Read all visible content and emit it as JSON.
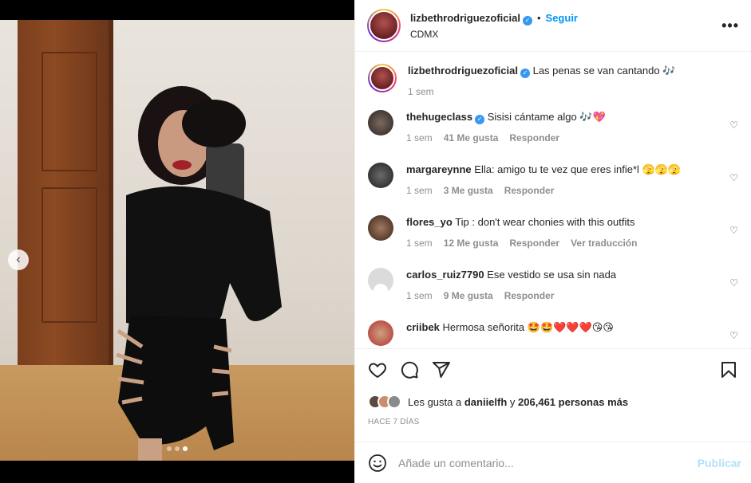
{
  "post": {
    "username": "lizbethrodriguezoficial",
    "follow_label": "Seguir",
    "separator": "•",
    "location": "CDMX",
    "more_label": "•••",
    "media_dots": 3,
    "media_active_dot": 2
  },
  "caption": {
    "username": "lizbethrodriguezoficial",
    "text": "Las penas se van cantando 🎶",
    "time": "1 sem"
  },
  "comments": [
    {
      "username": "thehugeclass",
      "verified": true,
      "text": "Sisisi cántame algo 🎶💖",
      "time": "1 sem",
      "likes": "41 Me gusta",
      "reply": "Responder",
      "translate": ""
    },
    {
      "username": "margareynne",
      "verified": false,
      "text": "Ella: amigo tu te vez que eres infie*l 🫣🫣🫣",
      "time": "1 sem",
      "likes": "3 Me gusta",
      "reply": "Responder",
      "translate": ""
    },
    {
      "username": "flores_yo",
      "verified": false,
      "text": "Tip : don't wear chonies with this outfits",
      "time": "1 sem",
      "likes": "12 Me gusta",
      "reply": "Responder",
      "translate": "Ver traducción"
    },
    {
      "username": "carlos_ruiz7790",
      "verified": false,
      "text": "Ese vestido se usa sin nada",
      "time": "1 sem",
      "likes": "9 Me gusta",
      "reply": "Responder",
      "translate": ""
    },
    {
      "username": "criibek",
      "verified": false,
      "text": "Hermosa señorita 🤩🤩❤️❤️❤️😘😘",
      "time": "",
      "likes": "",
      "reply": "",
      "translate": ""
    }
  ],
  "likes": {
    "prefix": "Les gusta a",
    "user": "daniielfh",
    "middle": "y",
    "count": "206,461 personas más"
  },
  "date": "HACE 7 DÍAS",
  "add_comment": {
    "placeholder": "Añade un comentario...",
    "publish_label": "Publicar"
  },
  "icons": {
    "like": "heart-icon",
    "comment": "comment-icon",
    "share": "send-icon",
    "save": "bookmark-icon",
    "emoji": "emoji-icon",
    "verified": "verified-badge-icon"
  },
  "colors": {
    "accent": "#0095f6",
    "verified": "#3897f0",
    "muted": "#8e8e8e",
    "publish_disabled": "#b2dffc"
  }
}
